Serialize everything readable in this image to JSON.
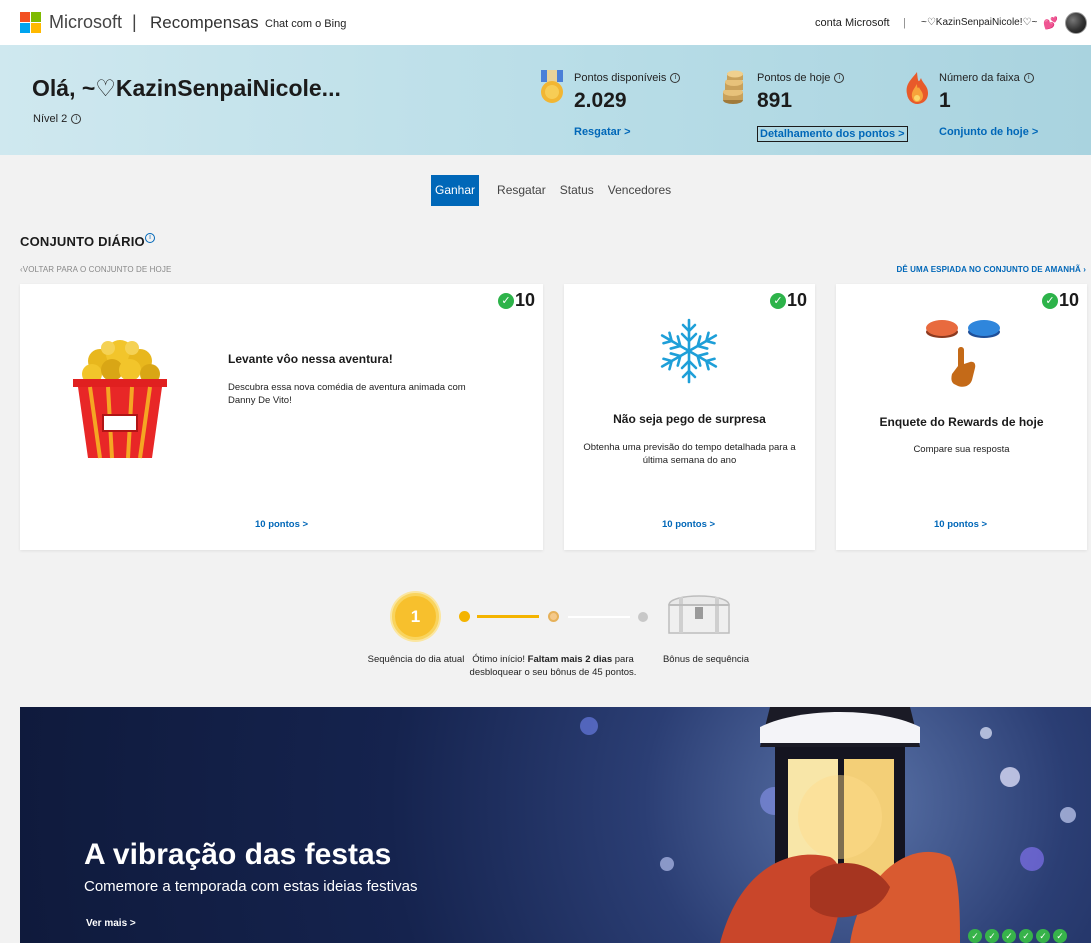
{
  "nav": {
    "brand": "Microsoft",
    "separator": "|",
    "product": "Recompensas",
    "chat_link": "Chat com o Bing",
    "account_link": "conta Microsoft",
    "account_sep": "|",
    "user_name": "~♡KazinSenpaiNicole!♡~",
    "heart_icon": "💕"
  },
  "hero": {
    "greeting": "Olá, ~♡KazinSenpaiNicole...",
    "level": "Nível 2",
    "stats": [
      {
        "label": "Pontos disponíveis",
        "value": "2.029",
        "link": "Resgatar >",
        "icon": "medal-icon"
      },
      {
        "label": "Pontos de hoje",
        "value": "891",
        "link": "Detalhamento dos pontos >",
        "icon": "coins-icon"
      },
      {
        "label": "Número da faixa",
        "value": "1",
        "link": "Conjunto de hoje >",
        "icon": "flame-icon"
      }
    ]
  },
  "tabs": [
    "Ganhar",
    "Resgatar",
    "Status",
    "Vencedores"
  ],
  "active_tab": "Ganhar",
  "daily_set": {
    "title": "CONJUNTO DIÁRIO",
    "info": "i",
    "back_link": "VOLTAR PARA O CONJUNTO DE HOJE",
    "peek_link": "DÊ UMA ESPIADA NO CONJUNTO DE AMANHÃ",
    "cards": [
      {
        "points": "10",
        "title": "Levante vôo nessa aventura!",
        "desc": "Descubra essa nova comédia de aventura animada com Danny De Vito!",
        "link": "10 pontos >"
      },
      {
        "points": "10",
        "title": "Não seja pego de surpresa",
        "desc": "Obtenha uma previsão do tempo detalhada para a última semana do ano",
        "link": "10 pontos >"
      },
      {
        "points": "10",
        "title": "Enquete do Rewards de hoje",
        "desc": "Compare sua resposta",
        "link": "10 pontos >"
      }
    ]
  },
  "streak": {
    "count": "1",
    "label_current": "Sequência do dia atual",
    "message_pre": "Ótimo início! ",
    "message_bold": "Faltam mais 2 dias",
    "message_post": " para desbloquear o seu bônus de 45 pontos.",
    "label_bonus": "Bônus de sequência"
  },
  "banner": {
    "title": "A vibração das festas",
    "subtitle": "Comemore a temporada com estas ideias festivas",
    "link": "Ver mais >",
    "check": "✓"
  },
  "colors": {
    "accent": "#0067b8",
    "check": "#2db34a",
    "streak": "#f4b400"
  }
}
